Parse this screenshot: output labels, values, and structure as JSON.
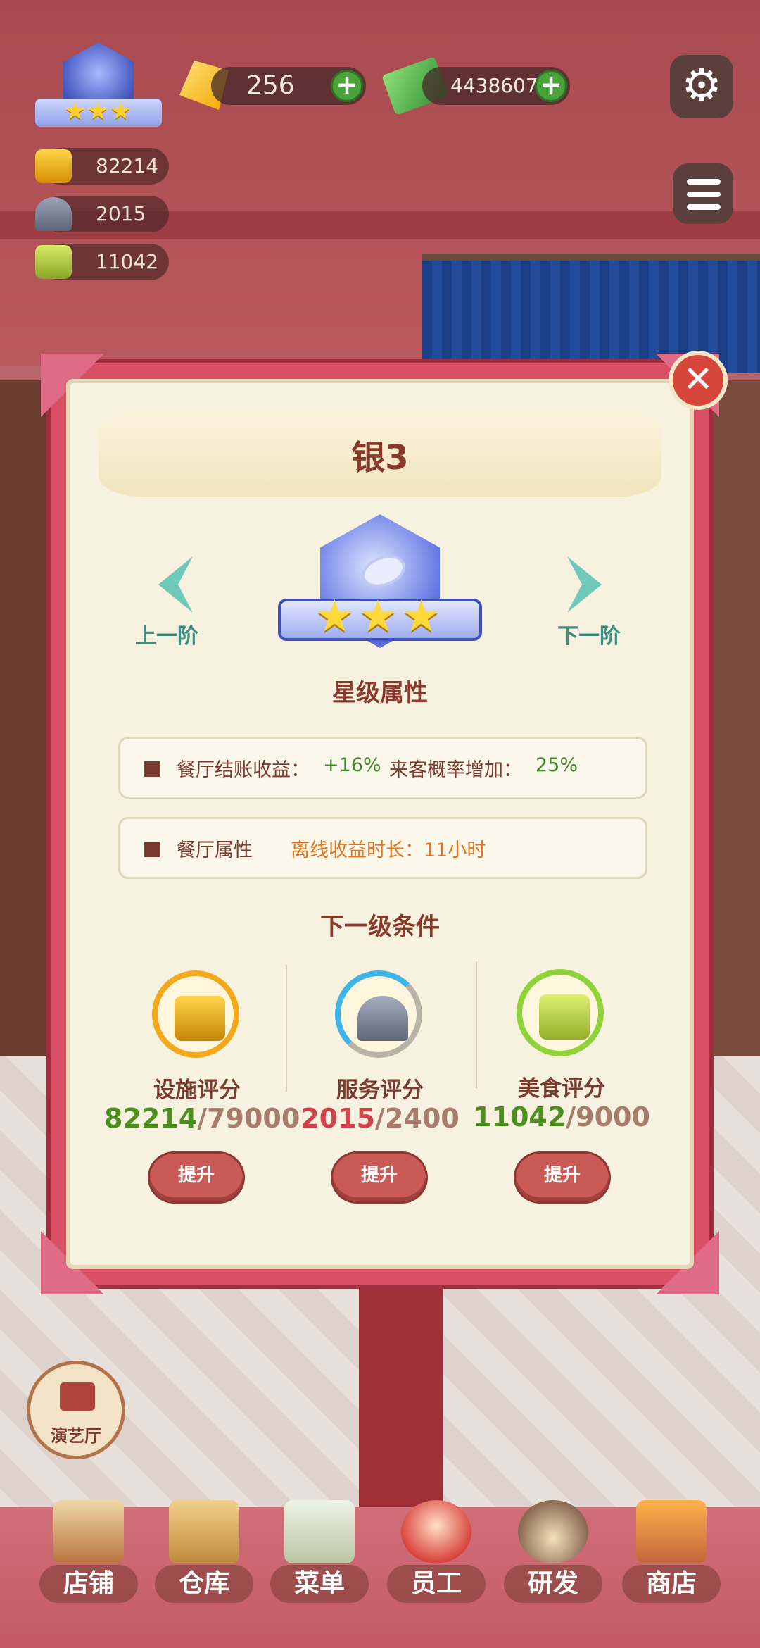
{
  "hud": {
    "rank_stars": "★★★",
    "gems": "256",
    "cash": "4438607",
    "plus": "+",
    "facility_score": "82214",
    "service_score": "2015",
    "food_score": "11042",
    "settings_glyph": "⚙"
  },
  "modal": {
    "title": "银3",
    "prev_label": "上一阶",
    "next_label": "下一阶",
    "badge_stars": "★★★",
    "close_glyph": "✕",
    "attr_section_title": "星级属性",
    "attr_row1": {
      "label1": "餐厅结账收益：",
      "value1": "+16%",
      "label2": "来客概率增加：",
      "value2": "25%"
    },
    "attr_row2": {
      "label": "餐厅属性",
      "detail": "离线收益时长：11小时"
    },
    "next_section_title": "下一级条件",
    "requirements": [
      {
        "label": "设施评分",
        "current": "82214",
        "sep": "/",
        "target": "79000",
        "button": "提升"
      },
      {
        "label": "服务评分",
        "current": "2015",
        "sep": "/",
        "target": "2400",
        "button": "提升"
      },
      {
        "label": "美食评分",
        "current": "11042",
        "sep": "/",
        "target": "9000",
        "button": "提升"
      }
    ]
  },
  "theater_label": "演艺厅",
  "bottom_nav": [
    "店铺",
    "仓库",
    "菜单",
    "员工",
    "研发",
    "商店"
  ],
  "colors": {
    "modal_border": "#d94f63",
    "panel_bg": "#f7f1df",
    "green_value": "#3c8a2a",
    "orange_value": "#e2721c",
    "progress_complete": "#4d8f1f",
    "progress_incomplete": "#d2414c",
    "facility_ring": "#f2a91c",
    "service_ring": "#3eb5e8",
    "food_ring": "#8fd33a"
  }
}
